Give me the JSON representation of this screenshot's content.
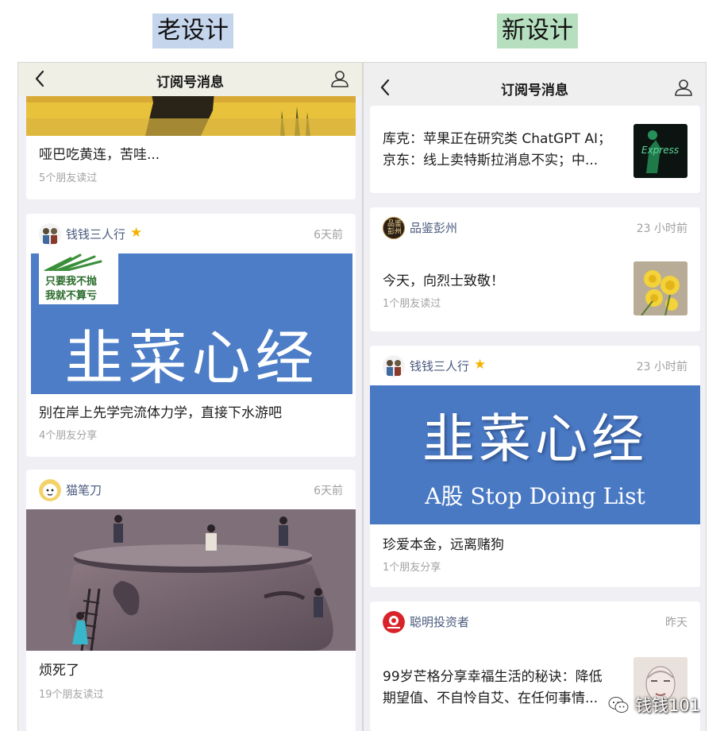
{
  "labels": {
    "old": "老设计",
    "new": "新设计"
  },
  "old": {
    "nav_title": "订阅号消息",
    "card1": {
      "title": "哑巴吃黄连，苦哇...",
      "stat": "5个朋友读过"
    },
    "card2": {
      "account": "钱钱三人行",
      "time": "6天前",
      "sign_line1": "只要我不抛",
      "sign_line2": "我就不算亏",
      "banner": "韭菜心经",
      "title": "别在岸上先学完流体力学，直接下水游吧",
      "stat": "4个朋友分享"
    },
    "card3": {
      "account": "猫笔刀",
      "time": "6天前",
      "title": "烦死了",
      "stat": "19个朋友读过"
    }
  },
  "new": {
    "nav_title": "订阅号消息",
    "card1": {
      "title_line1": "库克：苹果正在研究类 ChatGPT AI；",
      "title_line2": "京东：线上卖特斯拉消息不实；中...",
      "thumb_text": "Express"
    },
    "card2": {
      "account": "品鉴彭州",
      "avatar_text": "品鉴彭州",
      "time": "23 小时前",
      "title": "今天，向烈士致敬！",
      "stat": "1个朋友读过"
    },
    "card3": {
      "account": "钱钱三人行",
      "time": "23 小时前",
      "banner": "韭菜心经",
      "banner_sub": "A股 Stop Doing List",
      "title": "珍爱本金，远离赌狗",
      "stat": "1个朋友分享"
    },
    "card4": {
      "account": "聪明投资者",
      "time": "昨天",
      "title_line1": "99岁芒格分享幸福生活的秘诀：降低",
      "title_line2": "期望值、不自怜自艾、在任何事情..."
    }
  },
  "watermark": "钱钱101"
}
